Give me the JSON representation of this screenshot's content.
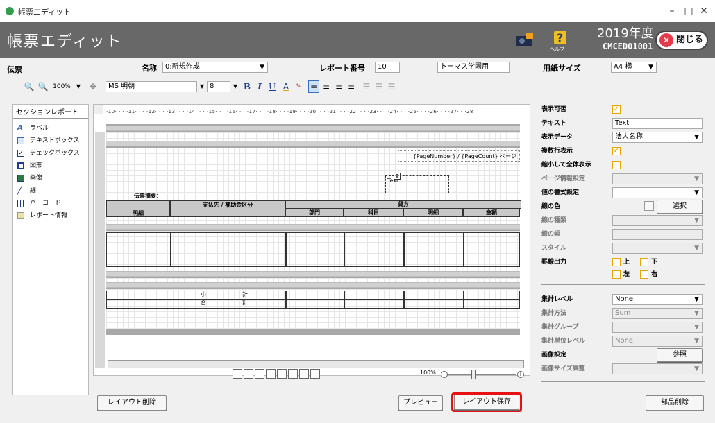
{
  "window": {
    "title": "帳票エディット",
    "minimize": "–",
    "maximize": "□",
    "close": "✕"
  },
  "header": {
    "title": "帳票エディット",
    "help_label": "ヘルプ",
    "year": "2019年度",
    "code": "CMCED01001",
    "close_label": "閉じる"
  },
  "form": {
    "denpyo": "伝票",
    "name_label": "名称",
    "name_value": "0:新規作成",
    "report_no_label": "レポート番号",
    "report_no_value": "10",
    "school_value": "トーマス学園用",
    "paper_label": "用紙サイズ",
    "paper_value": "A4 横"
  },
  "toolbar": {
    "zoom": "100%",
    "font": "MS 明朝",
    "size": "8",
    "bold": "B",
    "italic": "I",
    "underline": "U"
  },
  "left_panel": {
    "header": "セクションレポート",
    "items": [
      "ラベル",
      "テキストボックス",
      "チェックボックス",
      "図形",
      "画像",
      "線",
      "バーコード",
      "レポート情報"
    ]
  },
  "ruler": "·10· · · ·11· · · ·12· · · ·13· · · ·14· · · ·15· · · ·16· · · ·17· · · ·18· · · ·19· · · ·20· · · ·21· · · ·22· · · ·23· · · ·24· · · ·25· · · ·26· · · ·27· · ·28",
  "design": {
    "page_text": "{PageNumber} / {PageCount} ページ",
    "textbox": "Text",
    "summary_label": "伝票摘要：",
    "col_payee": "支払先 / 補助金区分",
    "col_kashikata": "貸方",
    "col_meisai": "明細",
    "col_bumon": "部門",
    "col_kamoku": "科目",
    "col_meisai2": "明細",
    "col_kingaku": "金額",
    "sub1": "小",
    "sub2": "計",
    "tot1": "合",
    "tot2": "計"
  },
  "zoom_level": "100%",
  "right_panel": {
    "rows": [
      {
        "label": "表示可否",
        "type": "check",
        "checked": true
      },
      {
        "label": "テキスト",
        "type": "text",
        "value": "Text"
      },
      {
        "label": "表示データ",
        "type": "select",
        "value": "法人名称"
      },
      {
        "label": "複数行表示",
        "type": "check",
        "checked": true
      },
      {
        "label": "縮小して全体表示",
        "type": "check",
        "checked": false
      },
      {
        "label": "ページ情報設定",
        "type": "select",
        "value": "",
        "disabled": true
      },
      {
        "label": "値の書式設定",
        "type": "select",
        "value": ""
      },
      {
        "label": "線の色",
        "type": "button",
        "value": "選択"
      },
      {
        "label": "線の種類",
        "type": "select",
        "value": "",
        "disabled": true
      },
      {
        "label": "線の幅",
        "type": "text",
        "value": "",
        "disabled": true
      },
      {
        "label": "スタイル",
        "type": "select",
        "value": "",
        "disabled": true
      },
      {
        "label": "罫線出力",
        "type": "borders"
      }
    ],
    "borders": {
      "top": "上",
      "bottom": "下",
      "left": "左",
      "right": "右"
    },
    "rows2": [
      {
        "label": "集計レベル",
        "type": "select",
        "value": "None"
      },
      {
        "label": "集計方法",
        "type": "select",
        "value": "Sum",
        "disabled": true
      },
      {
        "label": "集計グループ",
        "type": "select",
        "value": "",
        "disabled": true
      },
      {
        "label": "集計単位レベル",
        "type": "select",
        "value": "None",
        "disabled": true
      },
      {
        "label": "画像設定",
        "type": "button",
        "value": "参照"
      },
      {
        "label": "画像サイズ調整",
        "type": "select",
        "value": "",
        "disabled": true
      }
    ]
  },
  "footer": {
    "delete_layout": "レイアウト削除",
    "preview": "プレビュー",
    "save_layout": "レイアウト保存",
    "delete_part": "部品削除"
  },
  "colors": {
    "header_bg": "#686868",
    "highlight": "#e81010",
    "check": "#e8a400"
  }
}
